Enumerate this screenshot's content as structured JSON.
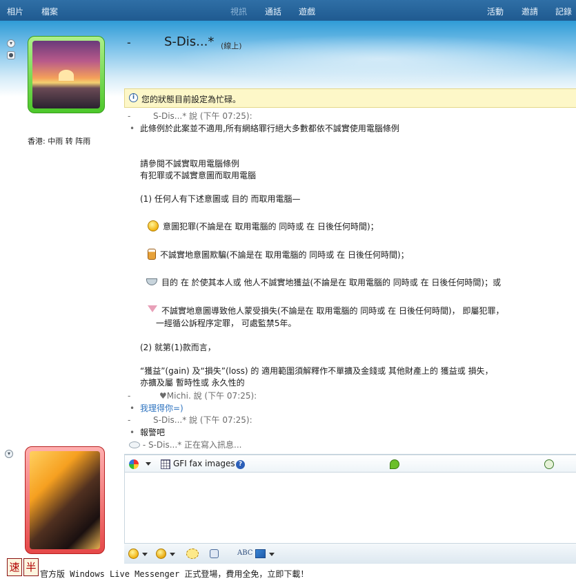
{
  "menu": {
    "left": [
      "相片",
      "檔案"
    ],
    "center": [
      "視訊",
      "通話",
      "遊戲"
    ],
    "right": [
      "活動",
      "邀請",
      "記錄"
    ]
  },
  "contact": {
    "dash": "-",
    "name": "S-Dis...*",
    "status": "(線上)",
    "location": "香港: 中雨 转 阵雨"
  },
  "notice": {
    "text": "您的狀態目前設定為忙碌。"
  },
  "messages": {
    "m1_header_dash": "-",
    "m1_header": "S-Dis...* 說 (下午 07:25):",
    "m1_bullet": "•",
    "m1_line1": "此條例於此案並不適用,所有網絡罪行絕大多數都依不誠實使用電腦條例",
    "m1_line2": "請參閱不誠實取用電腦條例",
    "m1_line3": "有犯罪或不誠實意圖而取用電腦",
    "m1_line4": "(1) 任何人有下述意圖或 目的 而取用電腦—",
    "m1_item1": "意圖犯罪(不論是在 取用電腦的 同時或 在 日後任何時間)；",
    "m1_item2": "不誠實地意圖欺騙(不論是在 取用電腦的 同時或 在 日後任何時間)；",
    "m1_item3": "目的 在 於使其本人或 他人不誠實地獲益(不論是在 取用電腦的 同時或 在 日後任何時間)；或",
    "m1_item4a": "不誠實地意圖導致他人蒙受損失(不論是在 取用電腦的 同時或 在 日後任何時間)， 即屬犯罪，",
    "m1_item4b": "一經循公訴程序定罪， 可處監禁5年。",
    "m1_line5": "(2) 就第(1)款而言，",
    "m1_line6": "“獲益”(gain) 及“損失”(loss) 的 適用範圍須解釋作不單擴及金錢或 其他財產上的 獲益或 損失，",
    "m1_line7": "亦擴及屬 暫時性或 永久性的",
    "m2_header": "♥Michi. 說 (下午 07:25):",
    "m2_line1": "我理得你=)",
    "m3_header": "S-Dis...* 說 (下午 07:25):",
    "m3_line1": "報警吧",
    "typing": "-          S-Dis...* 正在寫入訊息..."
  },
  "input_toolbar": {
    "gfi_label": "GFI fax images",
    "help": "?"
  },
  "bottom_toolbar": {
    "spell": "ABC"
  },
  "ime": [
    "速",
    "半"
  ],
  "footer": {
    "text": "官方版 Windows Live Messenger 正式登場，費用全免，立即下載！"
  },
  "icons": {
    "info": "info-icon",
    "smile": "smile-emoticon-icon",
    "beer": "beer-emoticon-icon",
    "coffee": "coffee-emoticon-icon",
    "cocktail": "cocktail-emoticon-icon"
  }
}
